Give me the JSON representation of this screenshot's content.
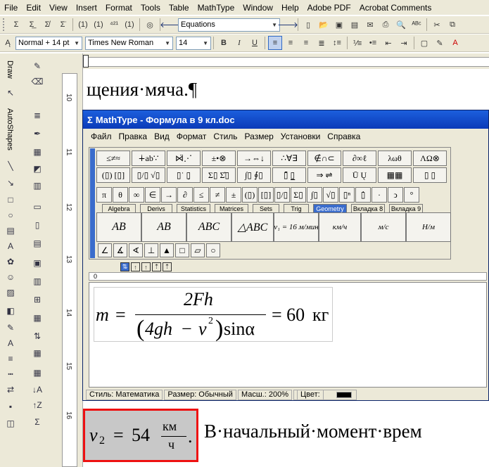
{
  "menubar": [
    "File",
    "Edit",
    "View",
    "Insert",
    "Format",
    "Tools",
    "Table",
    "MathType",
    "Window",
    "Help",
    "Adobe PDF",
    "Acrobat Comments"
  ],
  "toolbar2": {
    "style_combo": "Equations"
  },
  "toolbar3": {
    "style": "Normal + 14 pt",
    "font": "Times New Roman",
    "size": "14"
  },
  "leftbar": {
    "draw_label": "Draw",
    "autoshapes_label": "AutoShapes"
  },
  "ruler": {
    "numbers": [
      "10",
      "11",
      "12",
      "13",
      "14",
      "15",
      "16"
    ]
  },
  "document": {
    "line1": "щения·мяча.¶",
    "line2": "В·начальный·момент·врем"
  },
  "mathtype": {
    "title": "MathType - Формула в 9 кл.doc",
    "menu": [
      "Файл",
      "Правка",
      "Вид",
      "Формат",
      "Стиль",
      "Размер",
      "Установки",
      "Справка"
    ],
    "row1": [
      "≤≠≈",
      "∔ab∵",
      "⋈̈⋰",
      "±•⊗",
      "→⇔↓",
      "∴∀∃",
      "∉∩⊂",
      "∂∞ℓ",
      "λωθ",
      "ΛΩ⊗"
    ],
    "row2": [
      "(▯) [▯]",
      "▯/▯ √▯",
      "▯˙ ▯̣",
      "Σ▯ Σ̂▯",
      "∫▯ ∮▯",
      "▯̄ ▯̲",
      "⇒ ⇌",
      "Ū Ų",
      "▦▦",
      "▯ ▯"
    ],
    "row3": [
      "π",
      "θ",
      "∞",
      "∈",
      "→",
      "∂",
      "≤",
      "≠",
      "±",
      "(▯)",
      "[▯]",
      "▯/▯",
      "Σ▯",
      "∫▯",
      "√▯",
      "▯ⁿ",
      "▯̇",
      "·",
      "ↄ",
      "°"
    ],
    "tabs": [
      "Algebra",
      "Derivs",
      "Statistics",
      "Matrices",
      "Sets",
      "Trig",
      "Geometry",
      "Вкладка 8",
      "Вкладка 9"
    ],
    "templates": [
      "AB",
      "AB",
      "ABC",
      "△ABC",
      "v₁ = 16 м/мин",
      "км/ч",
      "м/с",
      "Н/м"
    ],
    "shapes": [
      "∠",
      "∡",
      "∢",
      "⊥",
      "▲",
      "□",
      "▱",
      "○"
    ],
    "formula": {
      "lhs": "m",
      "eq": "=",
      "num": "2Fh",
      "den_a": "4gh",
      "den_minus": "−",
      "den_v": "v",
      "den_exp": "2",
      "den_sin": "sinα",
      "result": "= 60",
      "unit": "кг"
    },
    "status": {
      "style": "Стиль: Математика",
      "size": "Размер: Обычный",
      "zoom": "Масш.: 200%",
      "color": "Цвет:"
    }
  },
  "selected_eq": {
    "lhs": "v",
    "sub": "2",
    "eq": "=",
    "val": "54",
    "num": "км",
    "den": "ч",
    "dot": "."
  }
}
